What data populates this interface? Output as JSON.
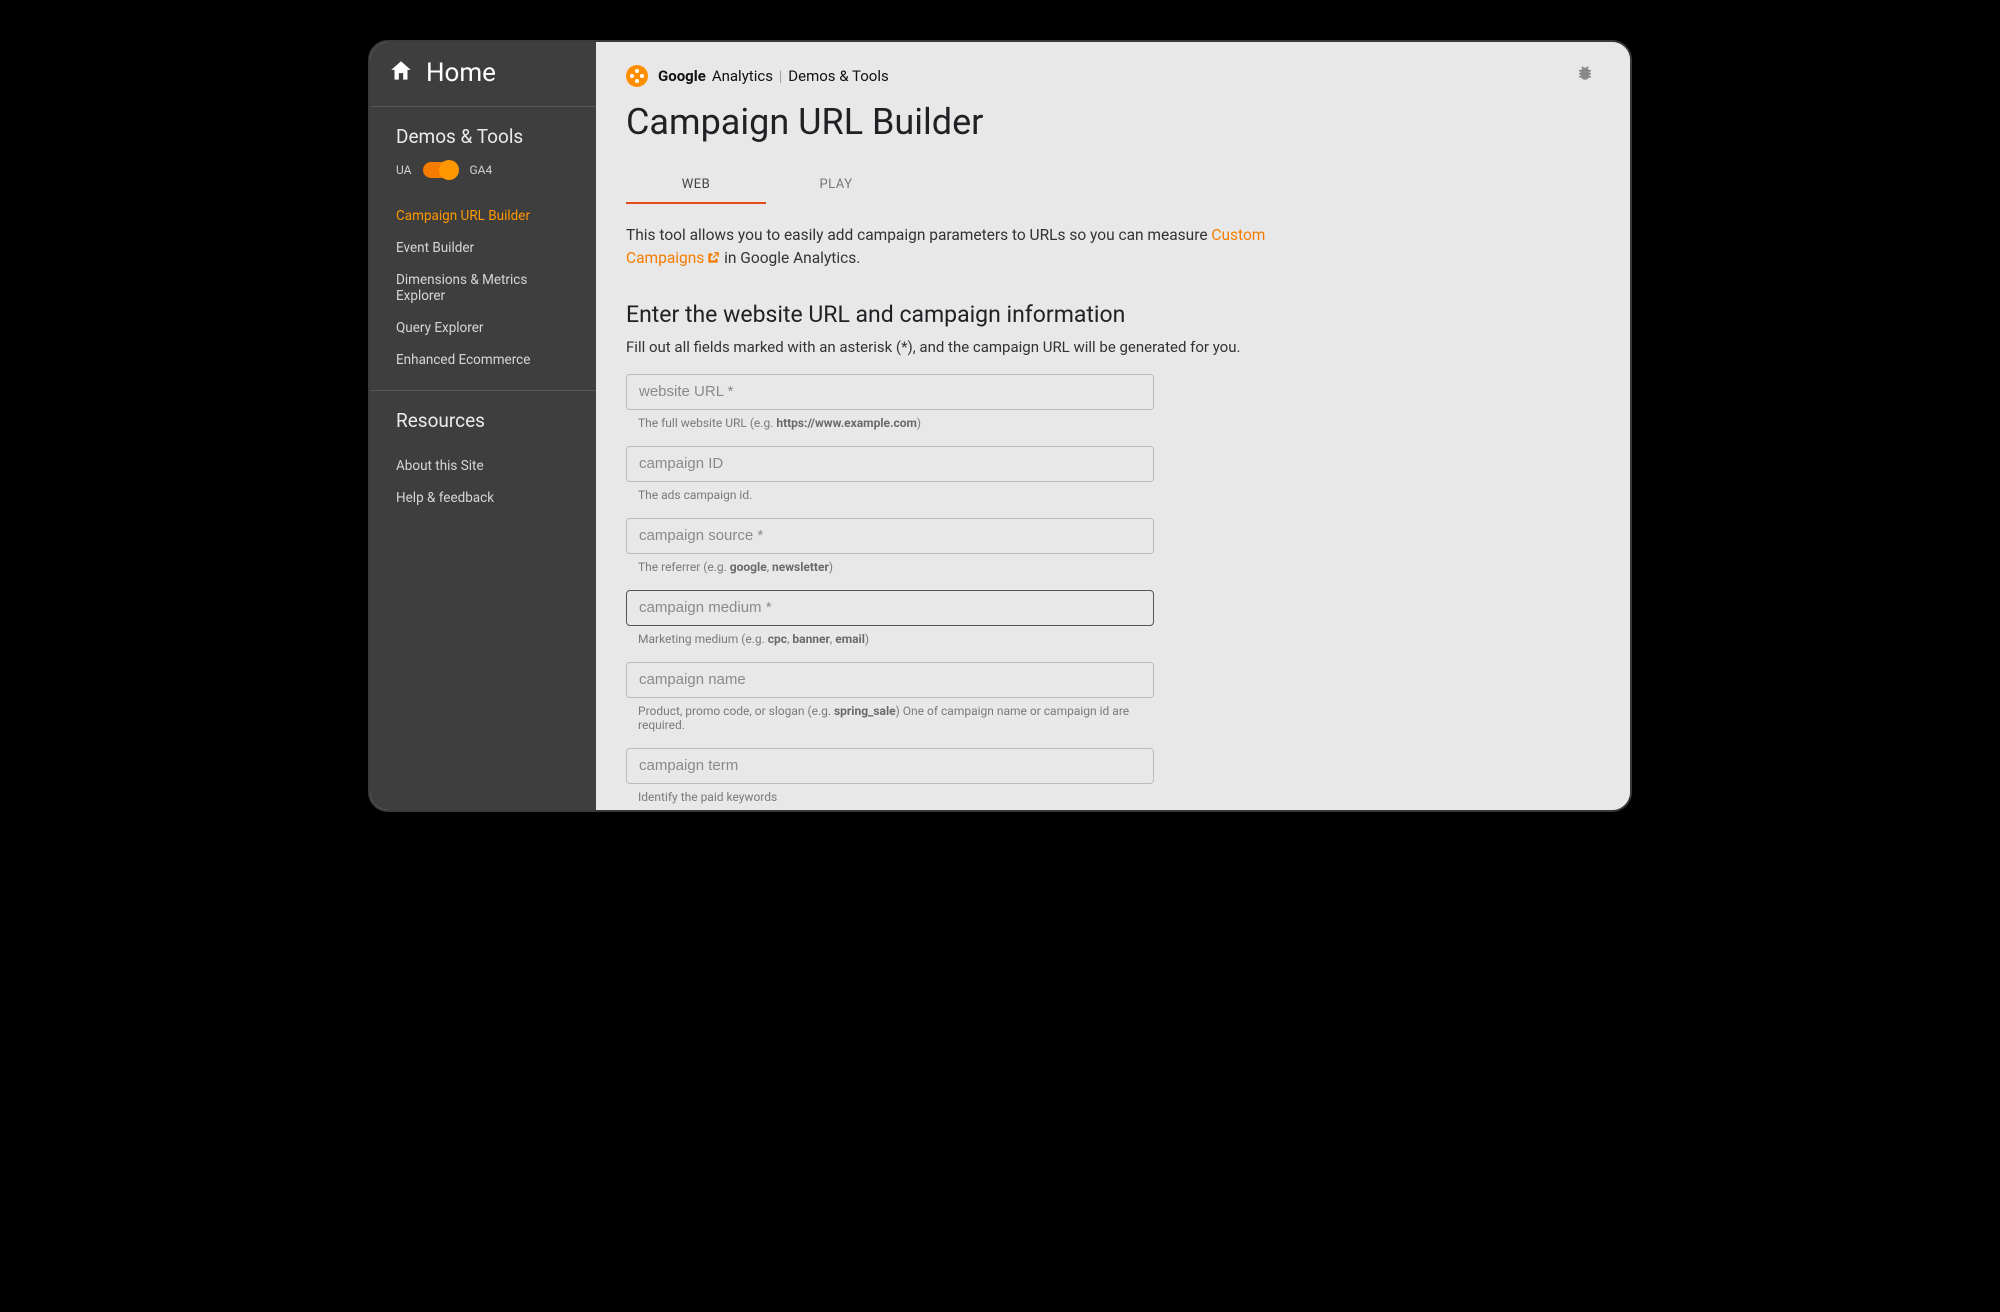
{
  "sidebar": {
    "home_label": "Home",
    "section1_title": "Demos & Tools",
    "toggle": {
      "left": "UA",
      "right": "GA4"
    },
    "nav_items": [
      {
        "label": "Campaign URL Builder",
        "active": true
      },
      {
        "label": "Event Builder",
        "active": false
      },
      {
        "label": "Dimensions & Metrics Explorer",
        "active": false
      },
      {
        "label": "Query Explorer",
        "active": false
      },
      {
        "label": "Enhanced Ecommerce",
        "active": false
      }
    ],
    "section2_title": "Resources",
    "resource_items": [
      {
        "label": "About this Site"
      },
      {
        "label": "Help & feedback"
      }
    ]
  },
  "header": {
    "brand_bold": "Google",
    "brand_light": "Analytics",
    "brand_suffix": "Demos & Tools"
  },
  "page": {
    "title": "Campaign URL Builder",
    "tabs": [
      {
        "label": "WEB",
        "active": true
      },
      {
        "label": "PLAY",
        "active": false
      }
    ],
    "intro_pre": "This tool allows you to easily add campaign parameters to URLs so you can measure ",
    "intro_link": "Custom Campaigns",
    "intro_post": " in Google Analytics.",
    "form_title": "Enter the website URL and campaign information",
    "form_sub": "Fill out all fields marked with an asterisk (*), and the campaign URL will be generated for you.",
    "fields": [
      {
        "name": "website-url",
        "placeholder": "website URL *",
        "helper_pre": "The full website URL (e.g. ",
        "helper_bold": "https://www.example.com",
        "helper_post": ")"
      },
      {
        "name": "campaign-id",
        "placeholder": "campaign ID",
        "helper_pre": "The ads campaign id.",
        "helper_bold": "",
        "helper_post": ""
      },
      {
        "name": "campaign-source",
        "placeholder": "campaign source *",
        "helper_pre": "The referrer (e.g. ",
        "helper_bold": "google",
        "helper_mid": ", ",
        "helper_bold2": "newsletter",
        "helper_post": ")"
      },
      {
        "name": "campaign-medium",
        "placeholder": "campaign medium *",
        "focused": true,
        "helper_pre": "Marketing medium (e.g. ",
        "helper_bold": "cpc",
        "helper_mid": ", ",
        "helper_bold2": "banner",
        "helper_mid2": ", ",
        "helper_bold3": "email",
        "helper_post": ")"
      },
      {
        "name": "campaign-name",
        "placeholder": "campaign name",
        "helper_pre": "Product, promo code, or slogan (e.g. ",
        "helper_bold": "spring_sale",
        "helper_post": ") One of campaign name or campaign id are required."
      },
      {
        "name": "campaign-term",
        "placeholder": "campaign term",
        "helper_pre": "Identify the paid keywords",
        "helper_bold": "",
        "helper_post": ""
      }
    ]
  }
}
